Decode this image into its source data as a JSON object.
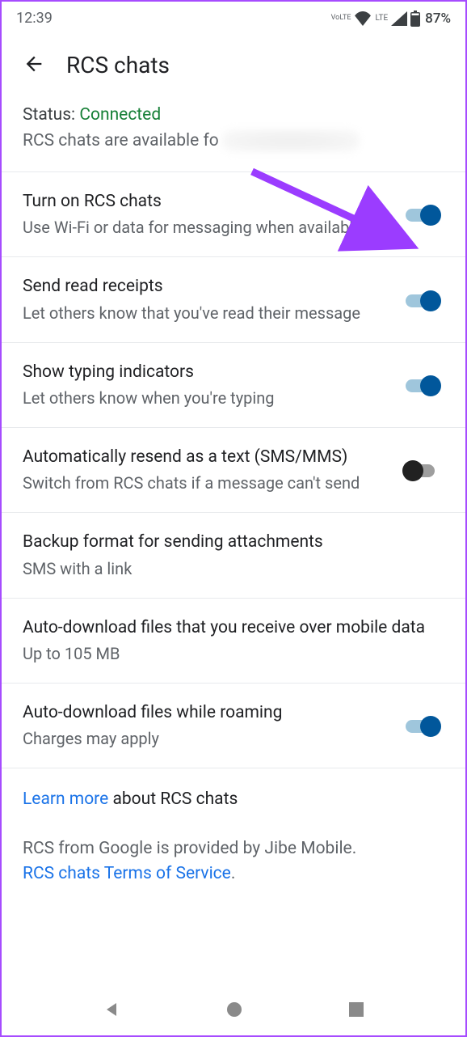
{
  "statusbar": {
    "time": "12:39",
    "volte": "VoLTE",
    "lte": "LTE",
    "battery": "87%"
  },
  "header": {
    "title": "RCS chats"
  },
  "statusBlock": {
    "label": "Status: ",
    "value": "Connected",
    "sub": "RCS chats are available fo"
  },
  "rows": {
    "rcs": {
      "title": "Turn on RCS chats",
      "sub": "Use Wi-Fi or data for messaging when available"
    },
    "receipts": {
      "title": "Send read receipts",
      "sub": "Let others know that you've read their message"
    },
    "typing": {
      "title": "Show typing indicators",
      "sub": "Let others know when you're typing"
    },
    "resend": {
      "title": "Automatically resend as a text (SMS/MMS)",
      "sub": "Switch from RCS chats if a message can't send"
    },
    "backup": {
      "title": "Backup format for sending attachments",
      "sub": "SMS with a link"
    },
    "autodl": {
      "title": "Auto-download files that you receive over mobile data",
      "sub": "Up to 105 MB"
    },
    "roaming": {
      "title": "Auto-download files while roaming",
      "sub": "Charges may apply"
    }
  },
  "footer": {
    "learnMore": "Learn more",
    "about": " about RCS chats",
    "provider": "RCS from Google is provided by Jibe Mobile.",
    "tos": "RCS chats Terms of Service",
    "period": "."
  }
}
